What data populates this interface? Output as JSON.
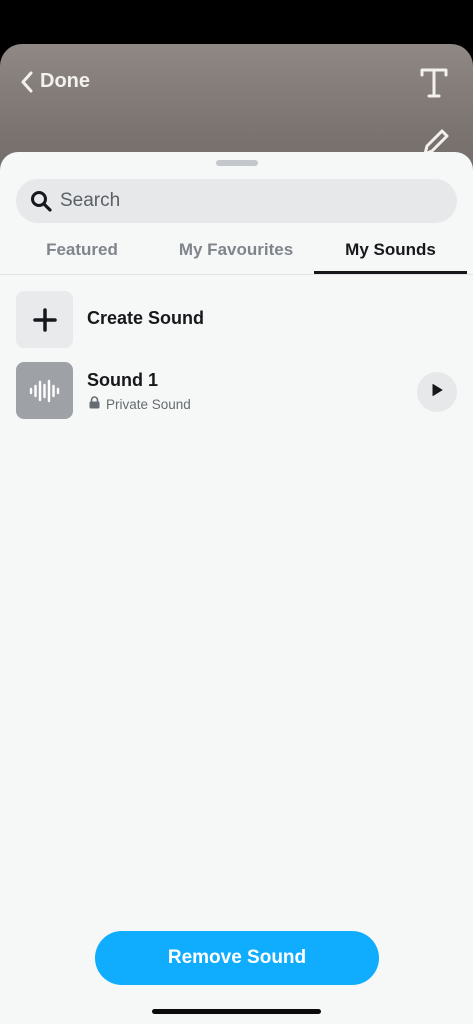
{
  "camera": {
    "done_label": "Done",
    "icons": [
      "chevron-left-icon",
      "text-tool-icon",
      "pen-tool-icon"
    ]
  },
  "search": {
    "placeholder": "Search",
    "icon": "search-icon"
  },
  "tabs": [
    {
      "label": "Featured",
      "selected": false
    },
    {
      "label": "My Favourites",
      "selected": false
    },
    {
      "label": "My Sounds",
      "selected": true
    }
  ],
  "items": [
    {
      "title": "Create Sound",
      "icon": "plus-icon"
    },
    {
      "title": "Sound 1",
      "subtitle": "Private Sound",
      "icon": "waveform-icon",
      "sub_icon": "lock-icon",
      "action_icon": "play-icon"
    }
  ],
  "footer": {
    "remove_label": "Remove Sound"
  },
  "colors": {
    "accent": "#10adff",
    "sheet_bg": "#f6f7f7",
    "text_primary": "#16191c",
    "text_secondary": "#7f858b"
  }
}
